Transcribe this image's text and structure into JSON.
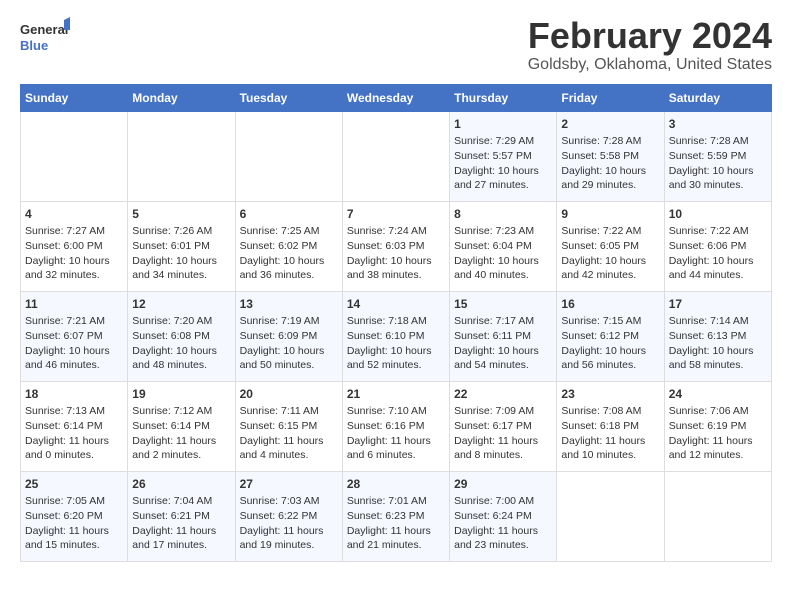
{
  "logo": {
    "line1": "General",
    "line2": "Blue"
  },
  "title": "February 2024",
  "subtitle": "Goldsby, Oklahoma, United States",
  "days_of_week": [
    "Sunday",
    "Monday",
    "Tuesday",
    "Wednesday",
    "Thursday",
    "Friday",
    "Saturday"
  ],
  "weeks": [
    [
      {
        "day": "",
        "info": ""
      },
      {
        "day": "",
        "info": ""
      },
      {
        "day": "",
        "info": ""
      },
      {
        "day": "",
        "info": ""
      },
      {
        "day": "1",
        "info": "Sunrise: 7:29 AM\nSunset: 5:57 PM\nDaylight: 10 hours and 27 minutes."
      },
      {
        "day": "2",
        "info": "Sunrise: 7:28 AM\nSunset: 5:58 PM\nDaylight: 10 hours and 29 minutes."
      },
      {
        "day": "3",
        "info": "Sunrise: 7:28 AM\nSunset: 5:59 PM\nDaylight: 10 hours and 30 minutes."
      }
    ],
    [
      {
        "day": "4",
        "info": "Sunrise: 7:27 AM\nSunset: 6:00 PM\nDaylight: 10 hours and 32 minutes."
      },
      {
        "day": "5",
        "info": "Sunrise: 7:26 AM\nSunset: 6:01 PM\nDaylight: 10 hours and 34 minutes."
      },
      {
        "day": "6",
        "info": "Sunrise: 7:25 AM\nSunset: 6:02 PM\nDaylight: 10 hours and 36 minutes."
      },
      {
        "day": "7",
        "info": "Sunrise: 7:24 AM\nSunset: 6:03 PM\nDaylight: 10 hours and 38 minutes."
      },
      {
        "day": "8",
        "info": "Sunrise: 7:23 AM\nSunset: 6:04 PM\nDaylight: 10 hours and 40 minutes."
      },
      {
        "day": "9",
        "info": "Sunrise: 7:22 AM\nSunset: 6:05 PM\nDaylight: 10 hours and 42 minutes."
      },
      {
        "day": "10",
        "info": "Sunrise: 7:22 AM\nSunset: 6:06 PM\nDaylight: 10 hours and 44 minutes."
      }
    ],
    [
      {
        "day": "11",
        "info": "Sunrise: 7:21 AM\nSunset: 6:07 PM\nDaylight: 10 hours and 46 minutes."
      },
      {
        "day": "12",
        "info": "Sunrise: 7:20 AM\nSunset: 6:08 PM\nDaylight: 10 hours and 48 minutes."
      },
      {
        "day": "13",
        "info": "Sunrise: 7:19 AM\nSunset: 6:09 PM\nDaylight: 10 hours and 50 minutes."
      },
      {
        "day": "14",
        "info": "Sunrise: 7:18 AM\nSunset: 6:10 PM\nDaylight: 10 hours and 52 minutes."
      },
      {
        "day": "15",
        "info": "Sunrise: 7:17 AM\nSunset: 6:11 PM\nDaylight: 10 hours and 54 minutes."
      },
      {
        "day": "16",
        "info": "Sunrise: 7:15 AM\nSunset: 6:12 PM\nDaylight: 10 hours and 56 minutes."
      },
      {
        "day": "17",
        "info": "Sunrise: 7:14 AM\nSunset: 6:13 PM\nDaylight: 10 hours and 58 minutes."
      }
    ],
    [
      {
        "day": "18",
        "info": "Sunrise: 7:13 AM\nSunset: 6:14 PM\nDaylight: 11 hours and 0 minutes."
      },
      {
        "day": "19",
        "info": "Sunrise: 7:12 AM\nSunset: 6:14 PM\nDaylight: 11 hours and 2 minutes."
      },
      {
        "day": "20",
        "info": "Sunrise: 7:11 AM\nSunset: 6:15 PM\nDaylight: 11 hours and 4 minutes."
      },
      {
        "day": "21",
        "info": "Sunrise: 7:10 AM\nSunset: 6:16 PM\nDaylight: 11 hours and 6 minutes."
      },
      {
        "day": "22",
        "info": "Sunrise: 7:09 AM\nSunset: 6:17 PM\nDaylight: 11 hours and 8 minutes."
      },
      {
        "day": "23",
        "info": "Sunrise: 7:08 AM\nSunset: 6:18 PM\nDaylight: 11 hours and 10 minutes."
      },
      {
        "day": "24",
        "info": "Sunrise: 7:06 AM\nSunset: 6:19 PM\nDaylight: 11 hours and 12 minutes."
      }
    ],
    [
      {
        "day": "25",
        "info": "Sunrise: 7:05 AM\nSunset: 6:20 PM\nDaylight: 11 hours and 15 minutes."
      },
      {
        "day": "26",
        "info": "Sunrise: 7:04 AM\nSunset: 6:21 PM\nDaylight: 11 hours and 17 minutes."
      },
      {
        "day": "27",
        "info": "Sunrise: 7:03 AM\nSunset: 6:22 PM\nDaylight: 11 hours and 19 minutes."
      },
      {
        "day": "28",
        "info": "Sunrise: 7:01 AM\nSunset: 6:23 PM\nDaylight: 11 hours and 21 minutes."
      },
      {
        "day": "29",
        "info": "Sunrise: 7:00 AM\nSunset: 6:24 PM\nDaylight: 11 hours and 23 minutes."
      },
      {
        "day": "",
        "info": ""
      },
      {
        "day": "",
        "info": ""
      }
    ]
  ]
}
